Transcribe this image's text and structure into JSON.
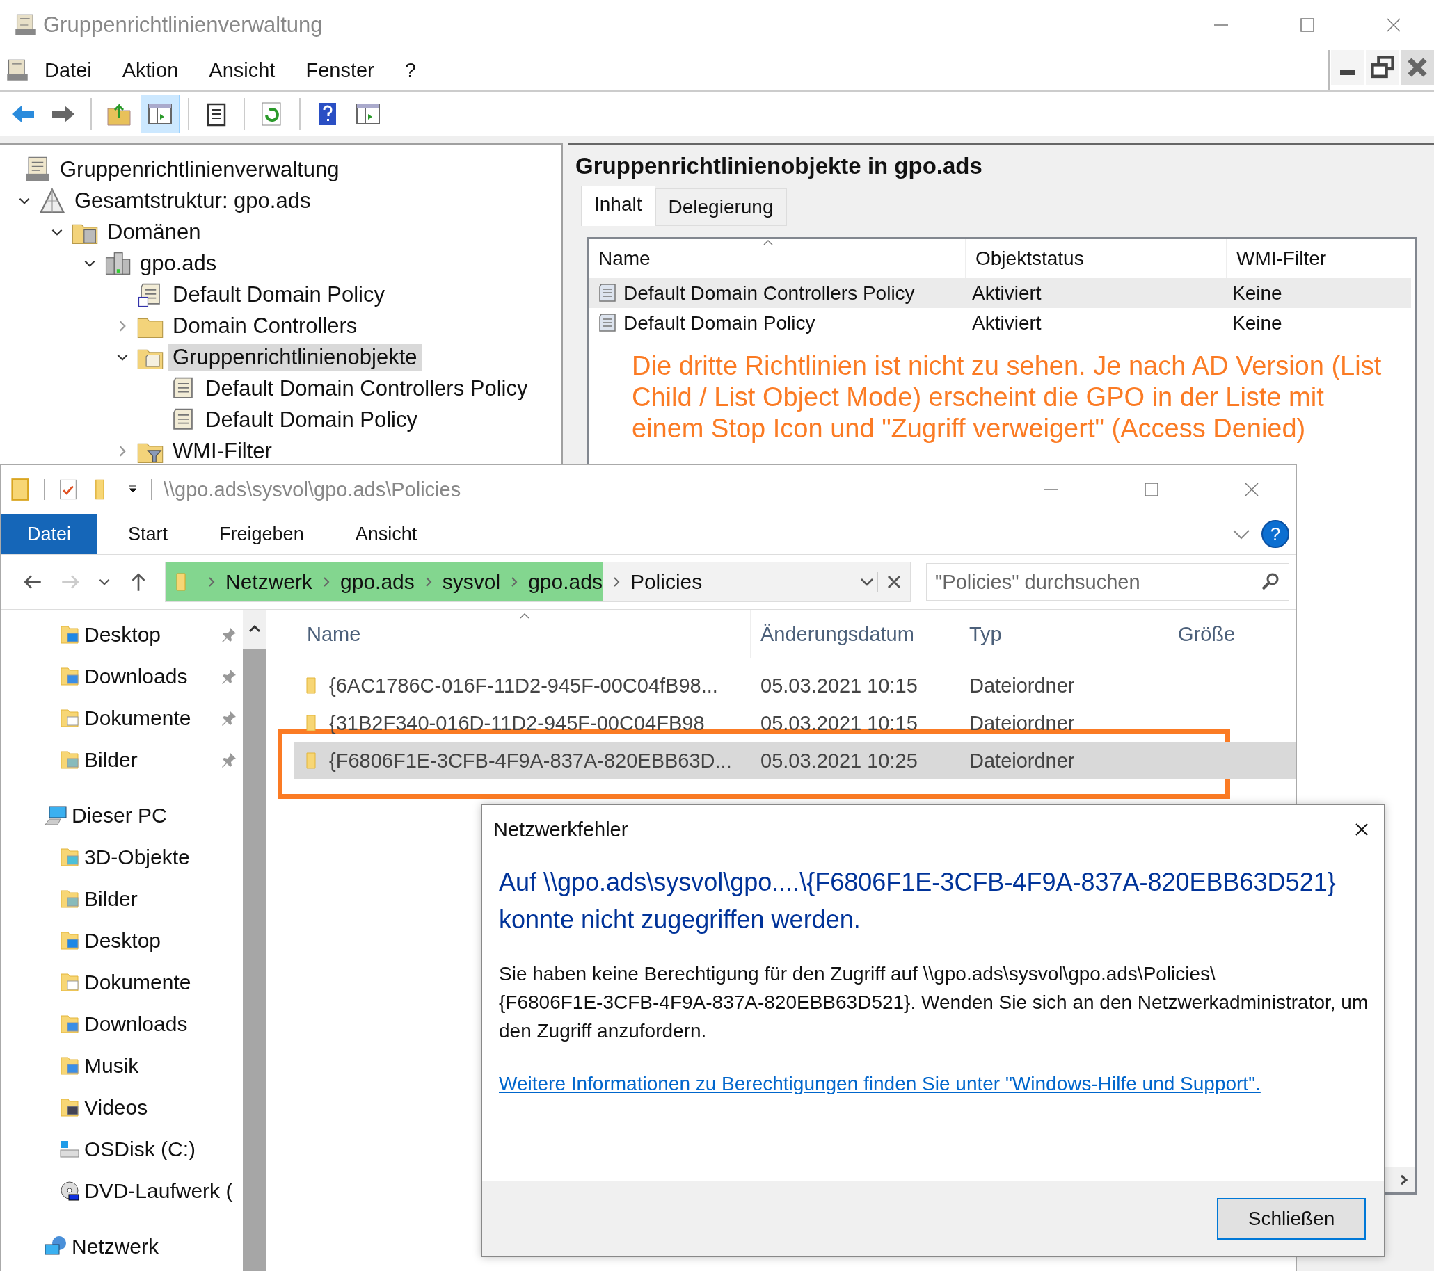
{
  "gpmc": {
    "title": "Gruppenrichtlinienverwaltung",
    "menu": [
      "Datei",
      "Aktion",
      "Ansicht",
      "Fenster",
      "?"
    ],
    "toolbar": [
      {
        "kind": "back",
        "selected": false
      },
      {
        "kind": "forward",
        "selected": false
      },
      {
        "kind": "sep"
      },
      {
        "kind": "up",
        "selected": false
      },
      {
        "kind": "tree",
        "selected": true
      },
      {
        "kind": "sep"
      },
      {
        "kind": "clipboard",
        "selected": false
      },
      {
        "kind": "sep"
      },
      {
        "kind": "refresh",
        "selected": false
      },
      {
        "kind": "sep"
      },
      {
        "kind": "help",
        "selected": false
      },
      {
        "kind": "pane",
        "selected": false
      }
    ],
    "tree": [
      {
        "label": "Gruppenrichtlinienverwaltung",
        "kind": "console",
        "selected": false,
        "children": [
          {
            "label": "Gesamtstruktur: gpo.ads",
            "kind": "forest",
            "expanded": true,
            "selected": false,
            "children": [
              {
                "label": "Domänen",
                "kind": "domains",
                "expanded": true,
                "selected": false,
                "children": [
                  {
                    "label": "gpo.ads",
                    "kind": "domain",
                    "expanded": true,
                    "selected": false,
                    "children": [
                      {
                        "label": "Default Domain Policy",
                        "kind": "gpolink",
                        "selected": false
                      },
                      {
                        "label": "Domain Controllers",
                        "kind": "ou",
                        "expanded": false,
                        "selected": false
                      },
                      {
                        "label": "Gruppenrichtlinienobjekte",
                        "kind": "gpofolder",
                        "expanded": true,
                        "selected": true,
                        "children": [
                          {
                            "label": "Default Domain Controllers Policy",
                            "kind": "gpo",
                            "selected": false
                          },
                          {
                            "label": "Default Domain Policy",
                            "kind": "gpo",
                            "selected": false
                          }
                        ]
                      },
                      {
                        "label": "WMI-Filter",
                        "kind": "wmi",
                        "expanded": false,
                        "selected": false
                      }
                    ]
                  }
                ]
              }
            ]
          }
        ]
      }
    ],
    "content": {
      "title": "Gruppenrichtlinienobjekte in gpo.ads",
      "tabs": [
        {
          "label": "Inhalt",
          "selected": true
        },
        {
          "label": "Delegierung",
          "selected": false
        }
      ],
      "columns": [
        "Name",
        "Objektstatus",
        "WMI-Filter"
      ],
      "rows": [
        {
          "cells": [
            "Default Domain Controllers Policy",
            "Aktiviert",
            "Keine"
          ],
          "selected": true
        },
        {
          "cells": [
            "Default Domain Policy",
            "Aktiviert",
            "Keine"
          ],
          "selected": false
        }
      ],
      "annotation": "Die dritte Richtlinien ist nicht zu sehen. Je nach AD Version (List Child / List Object Mode) erscheint die GPO in der Liste mit einem Stop Icon und \"Zugriff verweigert\" (Access Denied)"
    }
  },
  "explorer": {
    "title": "\\\\gpo.ads\\sysvol\\gpo.ads\\Policies",
    "ribbon_tabs": [
      {
        "label": "Datei",
        "selected": true
      },
      {
        "label": "Start",
        "selected": false
      },
      {
        "label": "Freigeben",
        "selected": false
      },
      {
        "label": "Ansicht",
        "selected": false
      }
    ],
    "help": "?",
    "breadcrumb": [
      {
        "label": "Netzwerk",
        "highlighted": true
      },
      {
        "label": "gpo.ads",
        "highlighted": true
      },
      {
        "label": "sysvol",
        "highlighted": true
      },
      {
        "label": "gpo.ads",
        "highlighted": true
      },
      {
        "label": "Policies",
        "highlighted": false
      }
    ],
    "search": {
      "placeholder": "\"Policies\" durchsuchen"
    },
    "quick_access": [
      {
        "label": "Desktop",
        "kind": "desktop",
        "pinned": true
      },
      {
        "label": "Downloads",
        "kind": "downloads",
        "pinned": true
      },
      {
        "label": "Dokumente",
        "kind": "documents",
        "pinned": true
      },
      {
        "label": "Bilder",
        "kind": "pictures",
        "pinned": true
      }
    ],
    "this_pc": {
      "label": "Dieser PC",
      "children": [
        {
          "label": "3D-Objekte",
          "kind": "objects3d"
        },
        {
          "label": "Bilder",
          "kind": "pictures"
        },
        {
          "label": "Desktop",
          "kind": "desktop"
        },
        {
          "label": "Dokumente",
          "kind": "documents"
        },
        {
          "label": "Downloads",
          "kind": "downloads"
        },
        {
          "label": "Musik",
          "kind": "music"
        },
        {
          "label": "Videos",
          "kind": "videos"
        },
        {
          "label": "OSDisk (C:)",
          "kind": "disk"
        },
        {
          "label": "DVD-Laufwerk (",
          "kind": "dvd"
        }
      ]
    },
    "network": {
      "label": "Netzwerk"
    },
    "columns": [
      "Name",
      "Änderungsdatum",
      "Typ",
      "Größe"
    ],
    "rows": [
      {
        "name": "{6AC1786C-016F-11D2-945F-00C04fB98...",
        "date": "05.03.2021 10:15",
        "type": "Dateiordner",
        "selected": false,
        "marked": false
      },
      {
        "name": "{31B2F340-016D-11D2-945F-00C04FB98",
        "date": "05.03.2021 10:15",
        "type": "Dateiordner",
        "selected": false,
        "marked": false
      },
      {
        "name": "{F6806F1E-3CFB-4F9A-837A-820EBB63D...",
        "date": "05.03.2021 10:25",
        "type": "Dateiordner",
        "selected": true,
        "marked": true
      }
    ]
  },
  "dialog": {
    "title": "Netzwerkfehler",
    "heading": "Auf \\\\gpo.ads\\sysvol\\gpo....\\{F6806F1E-3CFB-4F9A-837A-820EBB63D521} konnte nicht zugegriffen werden.",
    "message": "Sie haben keine Berechtigung für den Zugriff auf \\\\gpo.ads\\sysvol\\gpo.ads\\Policies\\\n{F6806F1E-3CFB-4F9A-837A-820EBB63D521}. Wenden Sie sich an den Netzwerkadministrator, um den Zugriff anzufordern.",
    "link": "Weitere Informationen zu Berechtigungen finden Sie unter \"Windows-Hilfe und Support\".",
    "button": "Schließen"
  }
}
